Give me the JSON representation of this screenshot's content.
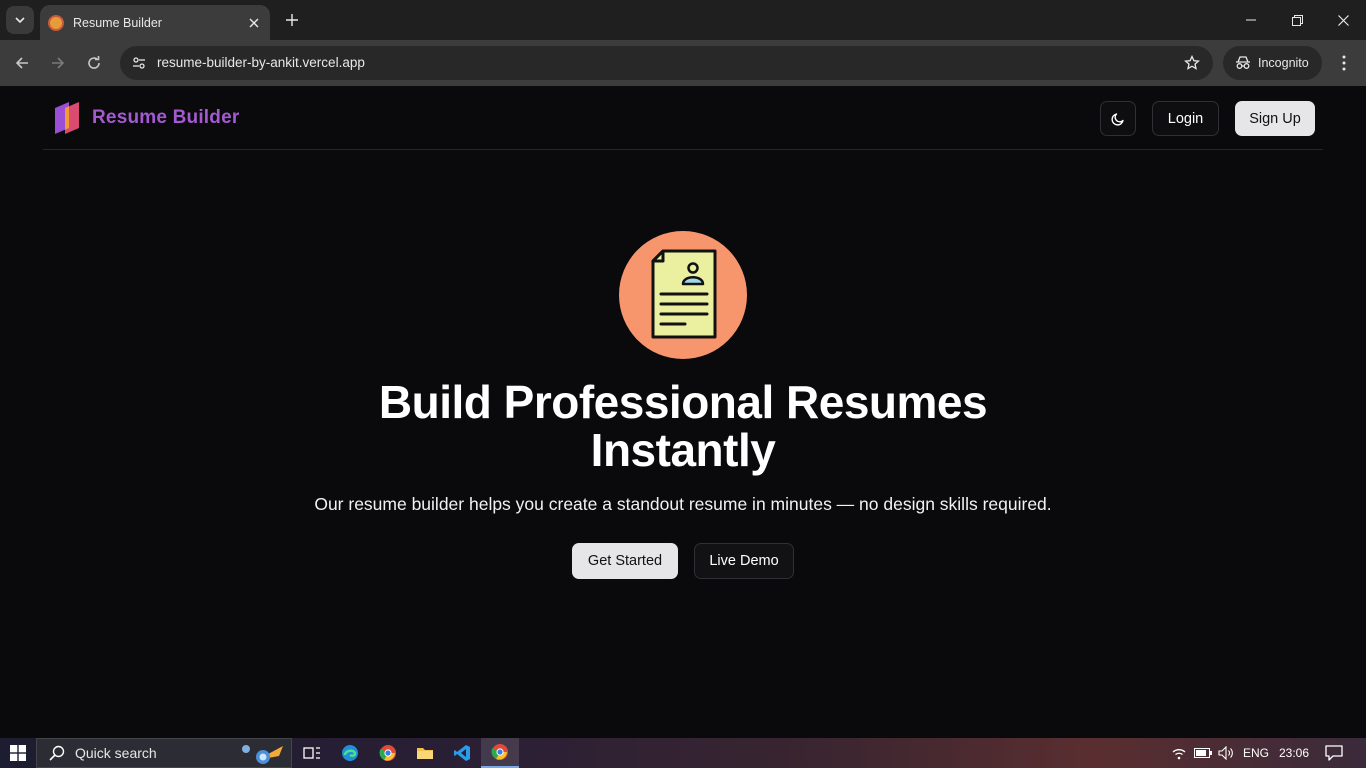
{
  "browser": {
    "tab_title": "Resume Builder",
    "url": "resume-builder-by-ankit.vercel.app",
    "incognito_label": "Incognito"
  },
  "nav": {
    "brand": "Resume Builder",
    "login": "Login",
    "signup": "Sign Up"
  },
  "hero": {
    "title_line1": "Build Professional Resumes",
    "title_line2": "Instantly",
    "subtitle": "Our resume builder helps you create a standout resume in minutes — no design skills required.",
    "cta_primary": "Get Started",
    "cta_secondary": "Live Demo"
  },
  "taskbar": {
    "search_placeholder": "Quick search",
    "language": "ENG",
    "time": "23:06"
  },
  "colors": {
    "brand": "#a35ad0",
    "icon_circle": "#f7966d",
    "document_fill": "#eaf0a0",
    "page_bg": "#0a0a0c"
  },
  "icons": [
    "search-icon",
    "close-icon",
    "plus-icon",
    "minimize-icon",
    "restore-icon",
    "back-icon",
    "forward-icon",
    "reload-icon",
    "site-settings-icon",
    "star-icon",
    "incognito-icon",
    "kebab-menu-icon",
    "moon-icon",
    "resume-document-icon",
    "windows-icon",
    "edge-icon",
    "chrome-icon",
    "folder-icon",
    "vscode-icon",
    "wifi-icon",
    "battery-icon",
    "volume-icon",
    "notification-icon"
  ]
}
